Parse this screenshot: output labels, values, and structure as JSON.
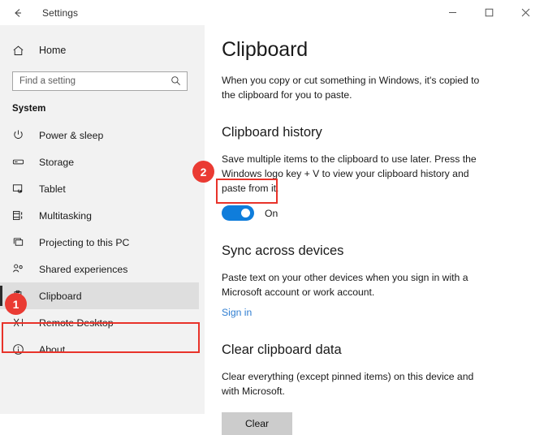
{
  "window": {
    "title": "Settings",
    "back_icon": "back-arrow-icon",
    "controls": [
      {
        "name": "minimize",
        "icon": "minimize-icon"
      },
      {
        "name": "maximize",
        "icon": "maximize-icon"
      },
      {
        "name": "close",
        "icon": "close-icon"
      }
    ]
  },
  "sidebar": {
    "home_label": "Home",
    "home_icon": "home-icon",
    "search": {
      "placeholder": "Find a setting",
      "value": "",
      "icon": "search-icon"
    },
    "group_title": "System",
    "items": [
      {
        "label": "Power & sleep",
        "icon": "power-icon",
        "selected": false
      },
      {
        "label": "Storage",
        "icon": "storage-icon",
        "selected": false
      },
      {
        "label": "Tablet",
        "icon": "tablet-icon",
        "selected": false
      },
      {
        "label": "Multitasking",
        "icon": "multitasking-icon",
        "selected": false
      },
      {
        "label": "Projecting to this PC",
        "icon": "projecting-icon",
        "selected": false
      },
      {
        "label": "Shared experiences",
        "icon": "shared-experiences-icon",
        "selected": false
      },
      {
        "label": "Clipboard",
        "icon": "clipboard-icon",
        "selected": true
      },
      {
        "label": "Remote Desktop",
        "icon": "remote-desktop-icon",
        "selected": false
      },
      {
        "label": "About",
        "icon": "about-icon",
        "selected": false
      }
    ]
  },
  "main": {
    "page_title": "Clipboard",
    "intro": "When you copy or cut something in Windows, it's copied to the clipboard for you to paste.",
    "sections": [
      {
        "heading": "Clipboard history",
        "description": "Save multiple items to the clipboard to use later. Press the Windows logo key + V to view your clipboard history and paste from it.",
        "toggle_state": "On"
      },
      {
        "heading": "Sync across devices",
        "description": "Paste text on your other devices when you sign in with a Microsoft account or work account.",
        "link": "Sign in"
      },
      {
        "heading": "Clear clipboard data",
        "description": "Clear everything (except pinned items) on this device and with Microsoft.",
        "button": "Clear"
      }
    ]
  },
  "annotations": {
    "badges": [
      {
        "label": "1"
      },
      {
        "label": "2"
      }
    ],
    "highlight_color": "#e8332a"
  },
  "colors": {
    "accent": "#0f7ddb",
    "link": "#2e7dd1",
    "sidebar_bg": "#f2f2f2",
    "selected_row": "#dedede",
    "annotation_red": "#e8332a",
    "badge_red": "#ea3b33"
  }
}
